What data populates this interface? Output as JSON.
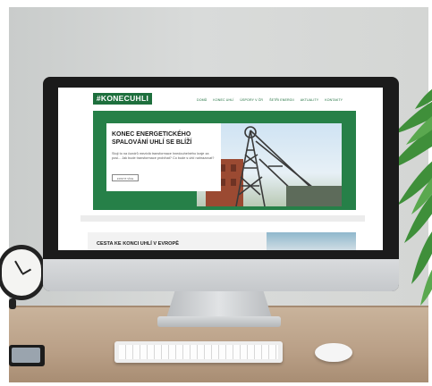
{
  "site": {
    "logo": "#KONECUHLI",
    "nav": [
      "DOMŮ",
      "KONEC UHLÍ",
      "ÚSPORY V ČR",
      "ŠETŘI ENERGII",
      "AKTUALITY",
      "KONTAKTY"
    ]
  },
  "hero": {
    "title": "KONEC ENERGETICKÉHO SPALOVÁNÍ UHLÍ SE BLÍŽÍ",
    "body": "Stojí to na čundrů mezivlá transformace hnedouhelného kraje za posl... Jak bude transformace probíhat? Co bude s uhlí nahrazovat?",
    "button": "ZJISTIT VÍCE"
  },
  "section2": {
    "title": "CESTA KE KONCI UHLÍ V EVROPĚ"
  },
  "colors": {
    "brand_green": "#268048",
    "logo_green": "#1e6f3d"
  }
}
